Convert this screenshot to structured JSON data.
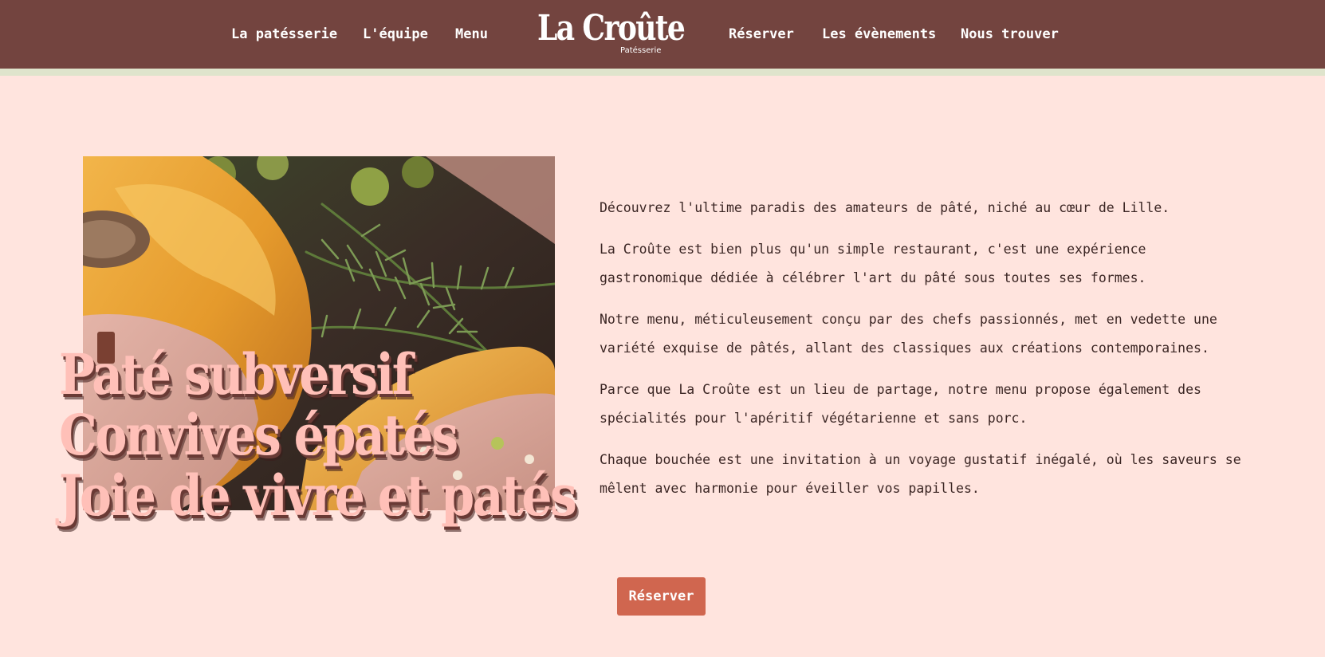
{
  "nav": {
    "left": [
      {
        "label": "La patésserie"
      },
      {
        "label": "L'équipe"
      },
      {
        "label": "Menu"
      }
    ],
    "right": [
      {
        "label": "Réserver"
      },
      {
        "label": "Les évènements"
      },
      {
        "label": "Nous trouver"
      }
    ]
  },
  "logo": {
    "name": "La Croûte",
    "tagline": "Patésserie"
  },
  "hero": {
    "lines": [
      "Paté subversif",
      "Convives épatés",
      "Joie de vivre et patés"
    ]
  },
  "intro": {
    "paragraphs": [
      "Découvrez l'ultime paradis des amateurs de pâté, niché au cœur de Lille.",
      "La Croûte est bien plus qu'un simple restaurant, c'est une expérience gastronomique dédiée à célébrer l'art du pâté sous toutes ses formes.",
      "Notre menu, méticuleusement conçu par des chefs passionnés, met en vedette une variété exquise de pâtés, allant des classiques aux créations contemporaines.",
      "Parce que La Croûte est un lieu de partage, notre menu propose également des spécialités pour l'apéritif végétarienne et sans porc.",
      "Chaque bouchée est une invitation à un voyage gustatif inégalé, où les saveurs se mêlent avec harmonie pour éveiller vos papilles."
    ]
  },
  "cta": {
    "label": "Réserver"
  },
  "colors": {
    "header_bg": "#73443f",
    "header_stripe": "#dfe4cc",
    "page_bg": "#ffe4de",
    "hero_text": "#ffc0b8",
    "button_bg": "#d0664f"
  }
}
